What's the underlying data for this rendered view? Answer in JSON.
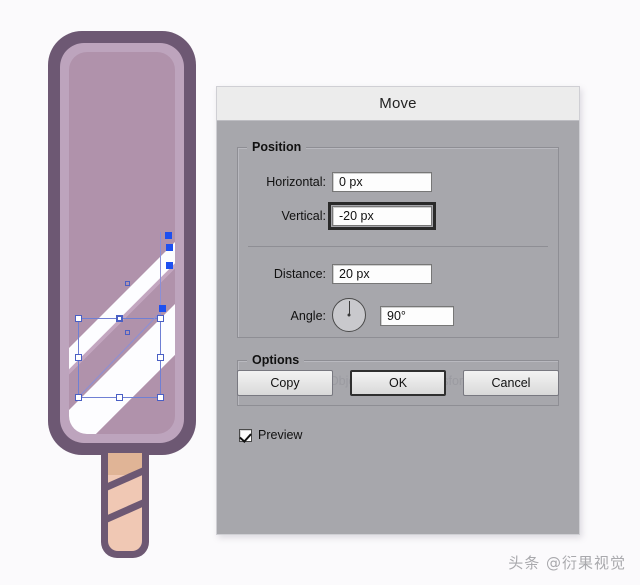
{
  "dialog": {
    "title": "Move",
    "position_group": {
      "legend": "Position",
      "horizontal": {
        "label": "Horizontal:",
        "value": "0 px"
      },
      "vertical": {
        "label": "Vertical:",
        "value": "-20 px",
        "focused": true
      },
      "distance": {
        "label": "Distance:",
        "value": "20 px"
      },
      "angle": {
        "label": "Angle:",
        "value": "90°",
        "dial_degrees": 90
      }
    },
    "options_group": {
      "legend": "Options",
      "transform_objects": {
        "label": "Transform Objects",
        "checked": true,
        "enabled": false
      },
      "transform_patterns": {
        "label": "Transform Patterns",
        "checked": false,
        "enabled": false
      }
    },
    "preview": {
      "label": "Preview",
      "checked": true
    },
    "buttons": {
      "copy": "Copy",
      "ok": "OK",
      "cancel": "Cancel"
    }
  },
  "illustration": {
    "name": "popsicle-vector-artwork",
    "colors": {
      "outline": "#6d5873",
      "body_mid": "#bda4bd",
      "body_inner": "#b092ab",
      "highlight": "#fdfdff",
      "stick": "#f0c8b4",
      "stick_shade": "#e0b496",
      "selection": "#6f7fd4",
      "anchor": "#1d4ff0"
    }
  },
  "canvas": {
    "background": "#fbfafc"
  },
  "watermark": {
    "text": "头条 @衍果视觉"
  }
}
